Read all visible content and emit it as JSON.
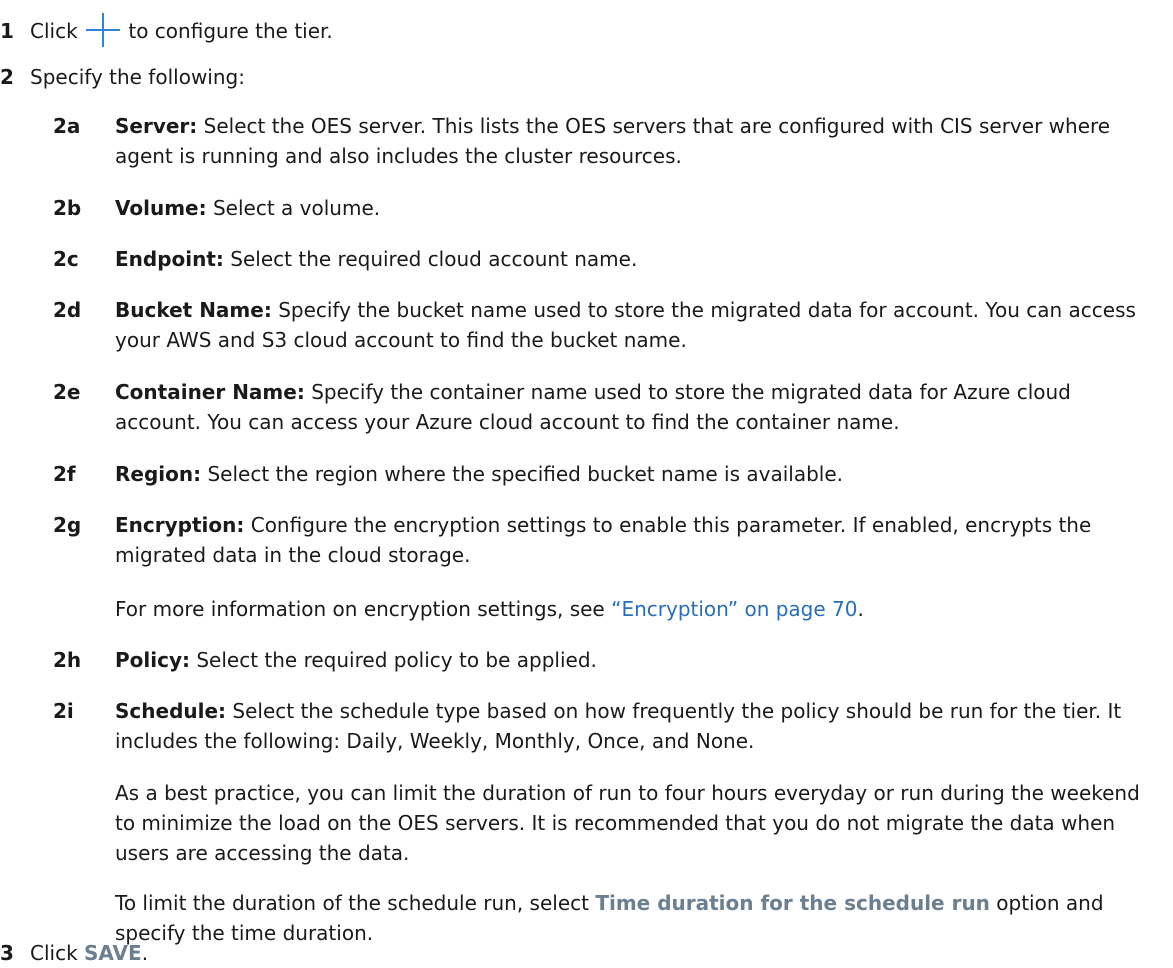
{
  "step1": {
    "num": "1",
    "pre": "Click",
    "post": "to configure the tier."
  },
  "step2": {
    "num": "2",
    "text": "Specify the following:"
  },
  "items": [
    {
      "num": "2a",
      "term": "Server:",
      "text": "Select the OES server. This lists the OES servers that are configured with CIS server where agent is running and also includes the cluster resources."
    },
    {
      "num": "2b",
      "term": "Volume:",
      "text": "Select a volume."
    },
    {
      "num": "2c",
      "term": "Endpoint:",
      "text": "Select the required cloud account name."
    },
    {
      "num": "2d",
      "term": "Bucket Name:",
      "text": "Specify the bucket name used to store the migrated data for account. You can access your AWS and S3 cloud account to find the bucket name."
    },
    {
      "num": "2e",
      "term": "Container Name:",
      "text": "Specify the container name used to store the migrated data for Azure cloud account. You can access your Azure cloud account to find the container name."
    },
    {
      "num": "2f",
      "term": "Region:",
      "text": "Select the region where the specified bucket name is available."
    },
    {
      "num": "2g",
      "term": "Encryption:",
      "text": "Configure the encryption settings to enable this parameter. If enabled, encrypts the migrated data in the cloud storage."
    },
    {
      "num": "2h",
      "term": "Policy:",
      "text": "Select the required policy to be applied."
    },
    {
      "num": "2i",
      "term": "Schedule:",
      "text": "Select the schedule type based on how frequently the policy should be run for the tier. It includes the following: Daily, Weekly, Monthly, Once, and None."
    }
  ],
  "encryption_note": {
    "pre": "For more information on encryption settings, see",
    "link": "“Encryption” on page 70",
    "post": "."
  },
  "best_practice": "As a best practice, you can limit the duration of run to four hours everyday or run during the weekend to minimize the load on the OES servers. It is recommended that you do not migrate the data when users are accessing the data.",
  "limit_note": {
    "pre": "To limit the duration of the schedule run, select",
    "ui": "Time duration for the schedule run",
    "post": "option and specify the time duration."
  },
  "step3": {
    "num": "3",
    "pre": "Click",
    "ui": "SAVE",
    "post": "."
  },
  "colors": {
    "accent_link": "#2a6ebb",
    "ui_label": "#6b7f90",
    "plus_icon": "#2f84d8"
  }
}
